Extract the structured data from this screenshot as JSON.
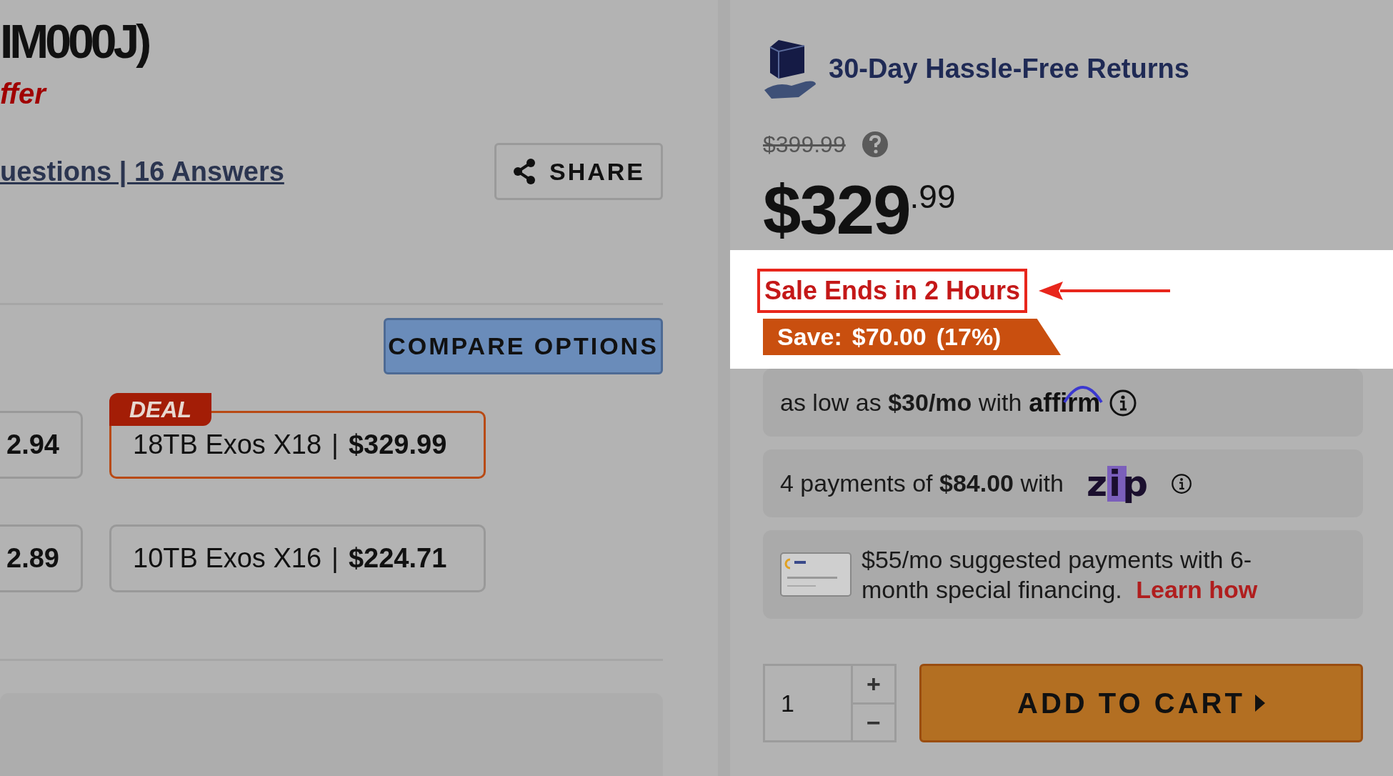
{
  "product": {
    "title": "IM000J)",
    "offer": "ffer",
    "qa_link": "uestions | 16 Answers",
    "share_button": "SHARE"
  },
  "compare_button": "COMPARE OPTIONS",
  "deal_badge": "DEAL",
  "options": [
    {
      "kind": "partial",
      "price": "2.94",
      "selected": false
    },
    {
      "kind": "full",
      "name": "18TB Exos X18",
      "separator": "|",
      "price": "$329.99",
      "deal": true,
      "selected": true
    },
    {
      "kind": "partial",
      "price": "2.89",
      "selected": false
    },
    {
      "kind": "full",
      "name": "10TB Exos X16",
      "separator": "|",
      "price": "$224.71",
      "selected": false
    }
  ],
  "returns": "30-Day Hassle-Free Returns",
  "list_price": "$399.99",
  "price": {
    "main": "$329",
    "cents": ".99"
  },
  "sale_notice": "Sale Ends in 2 Hours",
  "savings": {
    "label": "Save:",
    "amount": "$70.00",
    "percent": "(17%)"
  },
  "financing": [
    {
      "kind": "affirm",
      "text": "as low as **$30/mo** with",
      "logo": "affirm"
    },
    {
      "kind": "zip",
      "text": "4 payments of **$84.00** with",
      "logo": "zip"
    },
    {
      "kind": "card",
      "text": "$55/mo suggested payments with 6-month special financing.",
      "link": "Learn how"
    }
  ],
  "quantity": {
    "value": "1",
    "plus": "+",
    "minus": "−"
  },
  "add_to_cart": "ADD TO CART"
}
